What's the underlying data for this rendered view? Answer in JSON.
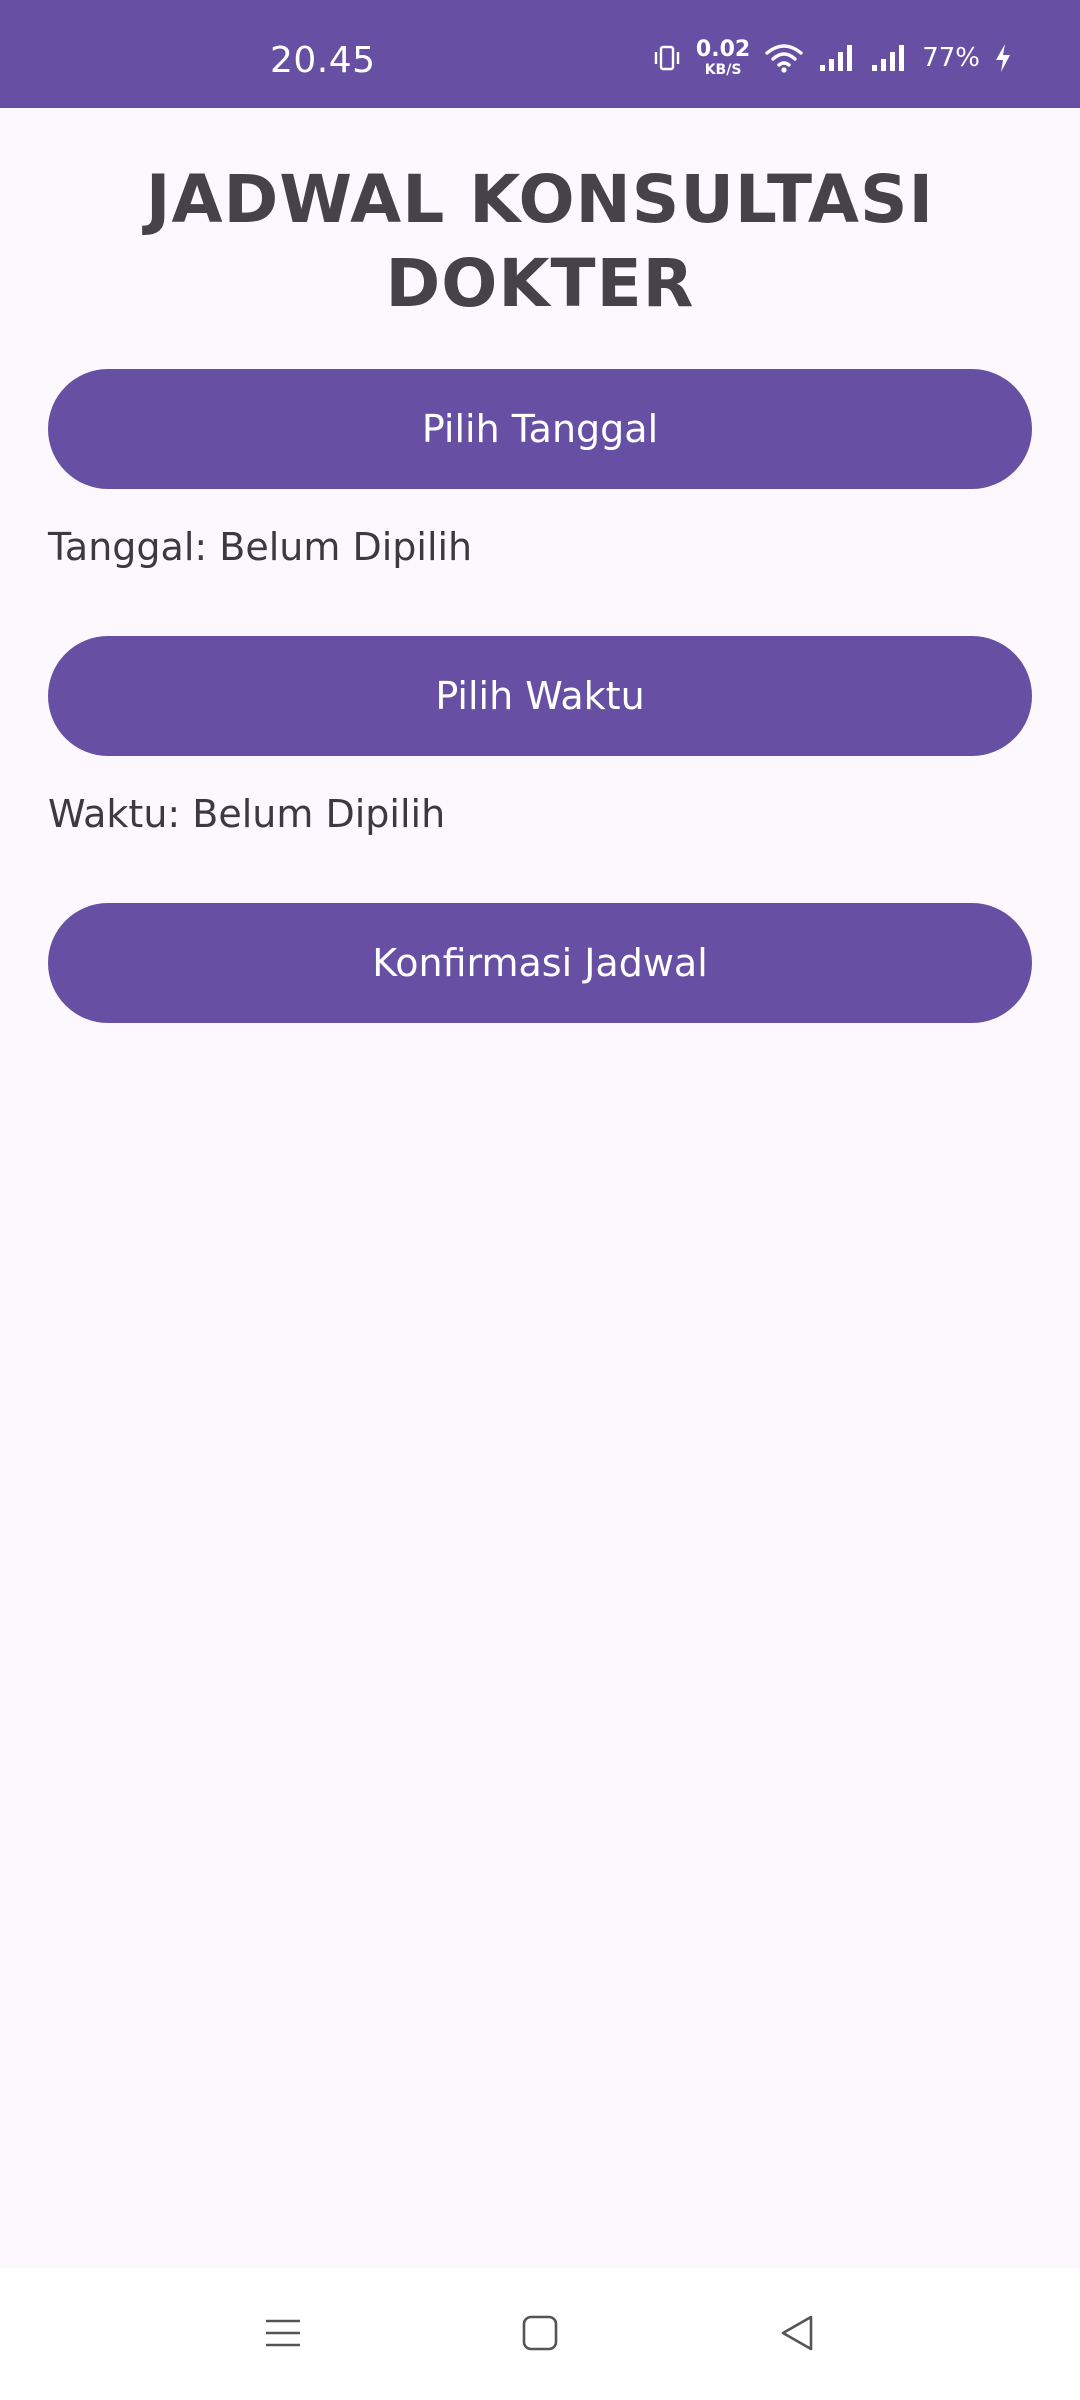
{
  "status_bar": {
    "time": "20.45",
    "net_speed_value": "0.02",
    "net_speed_unit": "KB/S",
    "battery": "77%",
    "icons": [
      "vibrate-icon",
      "wifi-icon",
      "signal-icon",
      "signal-icon",
      "charging-icon"
    ],
    "background_color": "#6750A4"
  },
  "page": {
    "title": "JADWAL KONSULTASI DOKTER",
    "background_color": "#FDF7FE"
  },
  "buttons": {
    "pick_date": "Pilih Tanggal",
    "pick_time": "Pilih Waktu",
    "confirm": "Konfirmasi Jadwal",
    "color": "#6750A4"
  },
  "info": {
    "date": "Tanggal: Belum Dipilih",
    "time": "Waktu: Belum Dipilih"
  },
  "nav_bar": {
    "icons": [
      "menu-icon",
      "home-icon",
      "back-icon"
    ]
  }
}
